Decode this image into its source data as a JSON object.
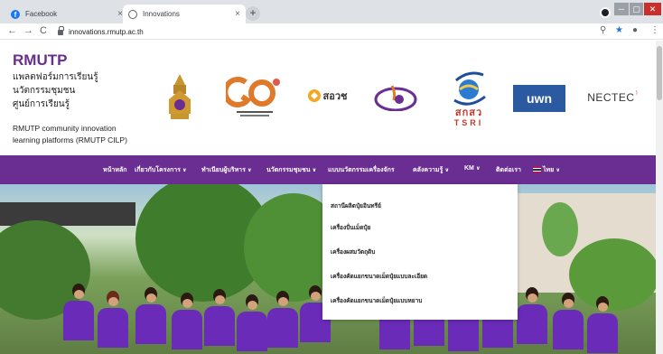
{
  "browser": {
    "tabs": [
      {
        "title": "Facebook",
        "close": "×"
      },
      {
        "title": "Innovations",
        "close": "×"
      }
    ],
    "newtab": "+",
    "url": "innovations.rmutp.ac.th",
    "nav": {
      "back": "←",
      "forward": "→",
      "reload": "C"
    },
    "window": {
      "minimize": "─",
      "maximize": "▢",
      "close": "✕"
    },
    "toolbar_icons": {
      "zoom": "⚲",
      "star": "★",
      "menu": "⋮",
      "account": "●"
    }
  },
  "header": {
    "brand": "RMUTP",
    "tagline": [
      "แพลตฟอร์มการเรียนรู้",
      "นวัตกรรมชุมชน",
      "ศูนย์การเรียนรู้"
    ],
    "cilp": [
      "RMUTP community innovation",
      "learning platforms (RMUTP CILP)"
    ],
    "logos": {
      "sorwor": "สอวช",
      "tsri_th": "สกสว",
      "tsri_en": "TSRI",
      "uwn": "uwn",
      "nectec": "NECTEC"
    }
  },
  "nav": {
    "items": [
      {
        "label": "หน้าหลัก",
        "caret": ""
      },
      {
        "label": "เกี่ยวกับโครงการ",
        "caret": "∨"
      },
      {
        "label": "ทำเนียบผู้บริหาร",
        "caret": "∨"
      },
      {
        "label": "นวัตกรรมชุมชน",
        "caret": "∨"
      },
      {
        "label": "แบบนวัตกรรมเครื่องจักร",
        "caret": ""
      },
      {
        "label": "คลังความรู้",
        "caret": "∨"
      },
      {
        "label": "KM",
        "caret": "∨"
      },
      {
        "label": "ติดต่อเรา",
        "caret": ""
      },
      {
        "label": "ไทย",
        "caret": "∨"
      }
    ]
  },
  "dropdown": {
    "items": [
      "สถานีผลิตปุ๋ยอินทรีย์",
      "เครื่องปั่นเม็ดปุ๋ย",
      "เครื่องผสมวัตถุดิบ",
      "เครื่องคัดแยกขนาดเม็ดปุ๋ยแบบละเอียด",
      "เครื่องคัดแยกขนาดเม็ดปุ๋ยแบบหยาบ"
    ]
  },
  "colors": {
    "brand_purple": "#6a2d91",
    "shirt_purple": "#6a2bb8"
  }
}
